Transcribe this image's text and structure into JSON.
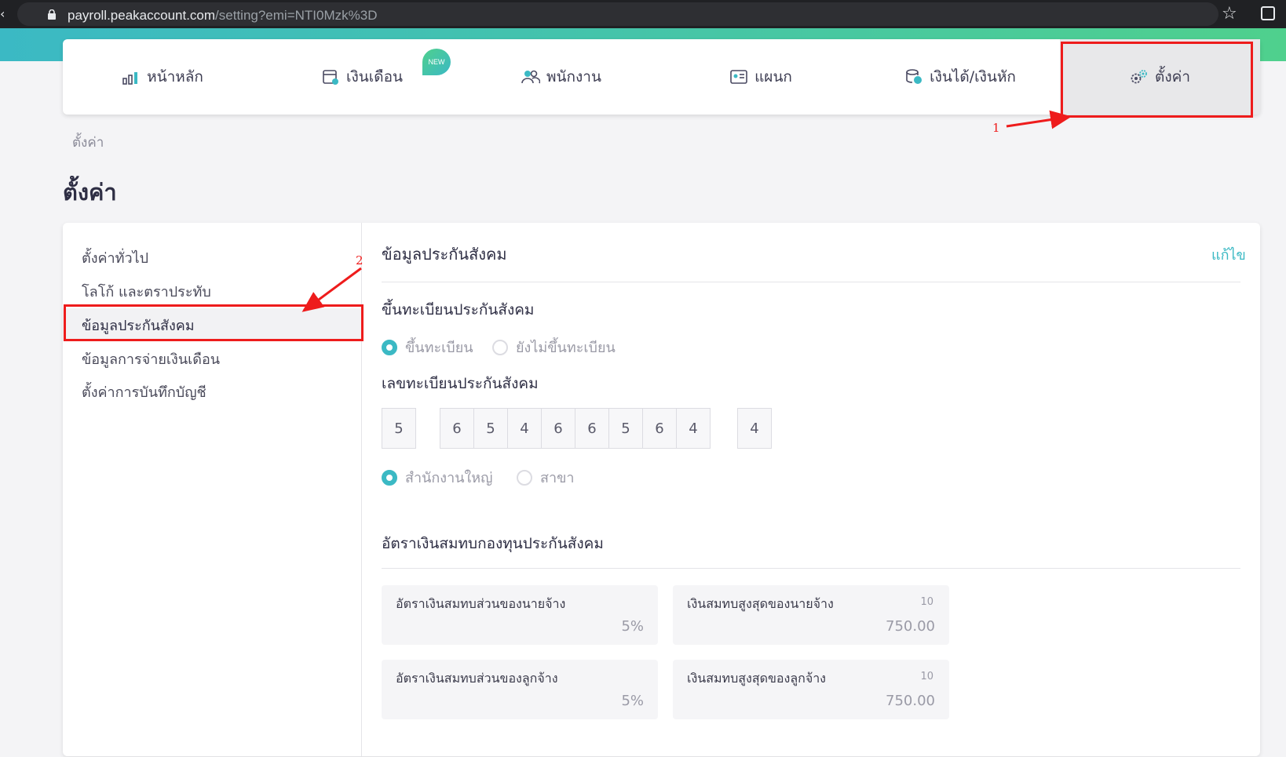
{
  "browser": {
    "url_host": "payroll.peakaccount.com",
    "url_path": "/setting?emi=NTI0Mzk%3D"
  },
  "nav": {
    "items": [
      {
        "label": "หน้าหลัก",
        "icon": "bar-chart-icon"
      },
      {
        "label": "เงินเดือน",
        "icon": "calendar-money-icon"
      },
      {
        "label": "พนักงาน",
        "icon": "people-icon"
      },
      {
        "label": "แผนก",
        "icon": "id-card-icon"
      },
      {
        "label": "เงินได้/เงินหัก",
        "icon": "coins-icon"
      },
      {
        "label": "ตั้งค่า",
        "icon": "gears-icon",
        "active": true
      }
    ],
    "new_badge": "NEW"
  },
  "breadcrumb": "ตั้งค่า",
  "page_title": "ตั้งค่า",
  "sidebar": {
    "items": [
      {
        "label": "ตั้งค่าทั่วไป"
      },
      {
        "label": "โลโก้ และตราประทับ"
      },
      {
        "label": "ข้อมูลประกันสังคม",
        "active": true
      },
      {
        "label": "ข้อมูลการจ่ายเงินเดือน"
      },
      {
        "label": "ตั้งค่าการบันทึกบัญชี"
      }
    ]
  },
  "content": {
    "title": "ข้อมูลประกันสังคม",
    "edit_label": "แก้ไข",
    "registration": {
      "title": "ขึ้นทะเบียนประกันสังคม",
      "option_registered": "ขึ้นทะเบียน",
      "option_not_registered": "ยังไม่ขึ้นทะเบียน",
      "selected": "registered"
    },
    "number": {
      "title": "เลขทะเบียนประกันสังคม",
      "group1": [
        "5"
      ],
      "group2": [
        "6",
        "5",
        "4",
        "6",
        "6",
        "5",
        "6",
        "4"
      ],
      "group3": [
        "4"
      ]
    },
    "office": {
      "option_hq": "สำนักงานใหญ่",
      "option_branch": "สาขา",
      "selected": "hq"
    },
    "contribution": {
      "title": "อัตราเงินสมทบกองทุนประกันสังคม",
      "employer_rate_label": "อัตราเงินสมทบส่วนของนายจ้าง",
      "employer_rate_value": "5%",
      "employer_max_label": "เงินสมทบสูงสุดของนายจ้าง",
      "employer_max_sup": "10",
      "employer_max_value": "750.00",
      "employee_rate_label": "อัตราเงินสมทบส่วนของลูกจ้าง",
      "employee_rate_value": "5%",
      "employee_max_label": "เงินสมทบสูงสุดของลูกจ้าง",
      "employee_max_sup": "10",
      "employee_max_value": "750.00"
    }
  },
  "annotations": {
    "step1": "1",
    "step2": "2"
  },
  "colors": {
    "accent": "#3bb9c4",
    "annotation": "#ee1c1c"
  }
}
